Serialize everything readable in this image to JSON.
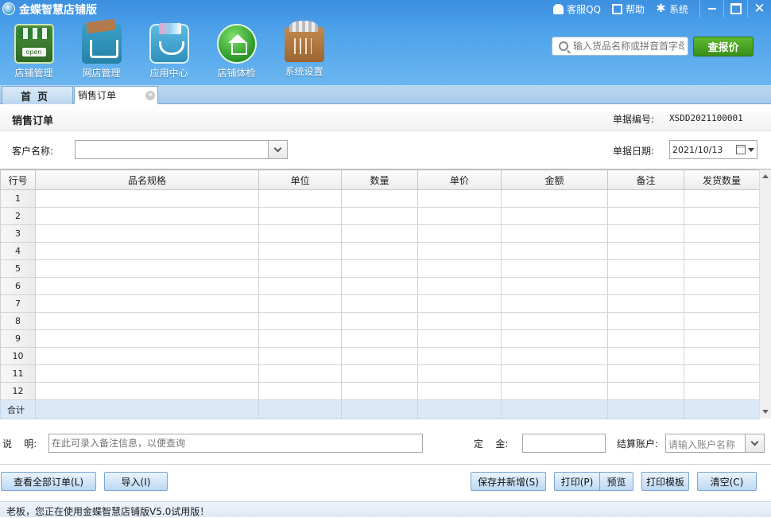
{
  "app": {
    "title": "金蝶智慧店铺版"
  },
  "top_links": {
    "qq": "客服QQ",
    "help": "帮助",
    "system": "系统"
  },
  "nav": [
    {
      "label": "店铺管理",
      "icon": "open-store-icon"
    },
    {
      "label": "网店管理",
      "icon": "shopping-cart-icon"
    },
    {
      "label": "应用中心",
      "icon": "app-basket-icon"
    },
    {
      "label": "店铺体检",
      "icon": "home-check-icon"
    },
    {
      "label": "系统设置",
      "icon": "toolbox-settings-icon"
    }
  ],
  "search": {
    "placeholder": "输入货品名称或拼音首字母",
    "button": "查报价"
  },
  "tabs": [
    {
      "label": "首页"
    },
    {
      "label": "销售订单"
    }
  ],
  "form": {
    "title": "销售订单",
    "doc_no_label": "单据编号:",
    "doc_no": "XSDD2021100001",
    "customer_label": "客户名称:",
    "customer_value": "",
    "date_label": "单据日期:",
    "date_value": "2021/10/13"
  },
  "grid": {
    "columns": [
      "行号",
      "品名规格",
      "单位",
      "数量",
      "单价",
      "金额",
      "备注",
      "发货数量"
    ],
    "rows": [
      "1",
      "2",
      "3",
      "4",
      "5",
      "6",
      "7",
      "8",
      "9",
      "10",
      "11",
      "12"
    ],
    "total_label": "合计"
  },
  "bottom": {
    "note_label": "说    明:",
    "note_placeholder": "在此可录入备注信息，以便查询",
    "deposit_label": "定    金:",
    "account_label": "结算账户:",
    "account_placeholder": "请输入账户名称"
  },
  "buttons": {
    "view_all": "查看全部订单(L)",
    "import": "导入(I)",
    "save_new": "保存并新增(S)",
    "print": "打印(P)",
    "preview": "预览",
    "print_template": "打印模板",
    "clear": "清空(C)"
  },
  "status": "老板，您正在使用金蝶智慧店铺版V5.0试用版！"
}
